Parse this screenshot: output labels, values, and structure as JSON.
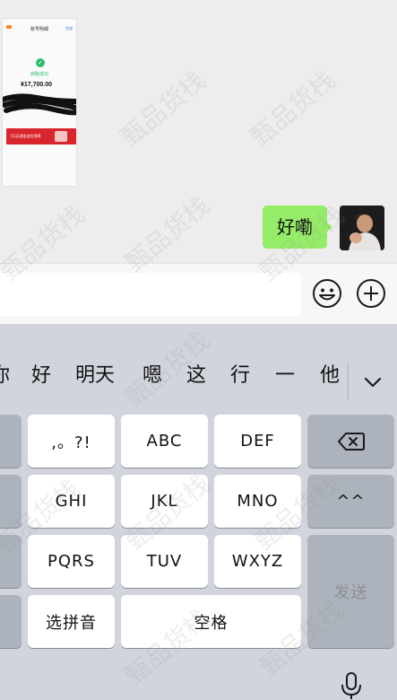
{
  "chat": {
    "image_message": {
      "title": "账号明细",
      "link": "完成",
      "status": "转账成功",
      "amount": "¥17,700.00",
      "banner_text": "7天无理由退货保障"
    },
    "sent_message": "好嘞"
  },
  "input_bar": {
    "text_value": "",
    "emoji_icon": "smiley-face-icon",
    "plus_icon": "plus-circle-icon"
  },
  "keyboard": {
    "candidates": [
      "你",
      "好",
      "明天",
      "嗯",
      "这",
      "行",
      "一",
      "他"
    ],
    "expand_icon": "chevron-down-icon",
    "keys": {
      "punct": ",。?!",
      "abc": "ABC",
      "def": "DEF",
      "ghi": "GHI",
      "jkl": "JKL",
      "mno": "MNO",
      "pqrs": "PQRS",
      "tuv": "TUV",
      "wxyz": "WXYZ",
      "pinyin": "选拼音",
      "space": "空格",
      "emoticon": "^^",
      "send": "发送"
    },
    "delete_icon": "backspace-icon",
    "mic_icon": "microphone-icon"
  },
  "watermark": "甄品货栈"
}
